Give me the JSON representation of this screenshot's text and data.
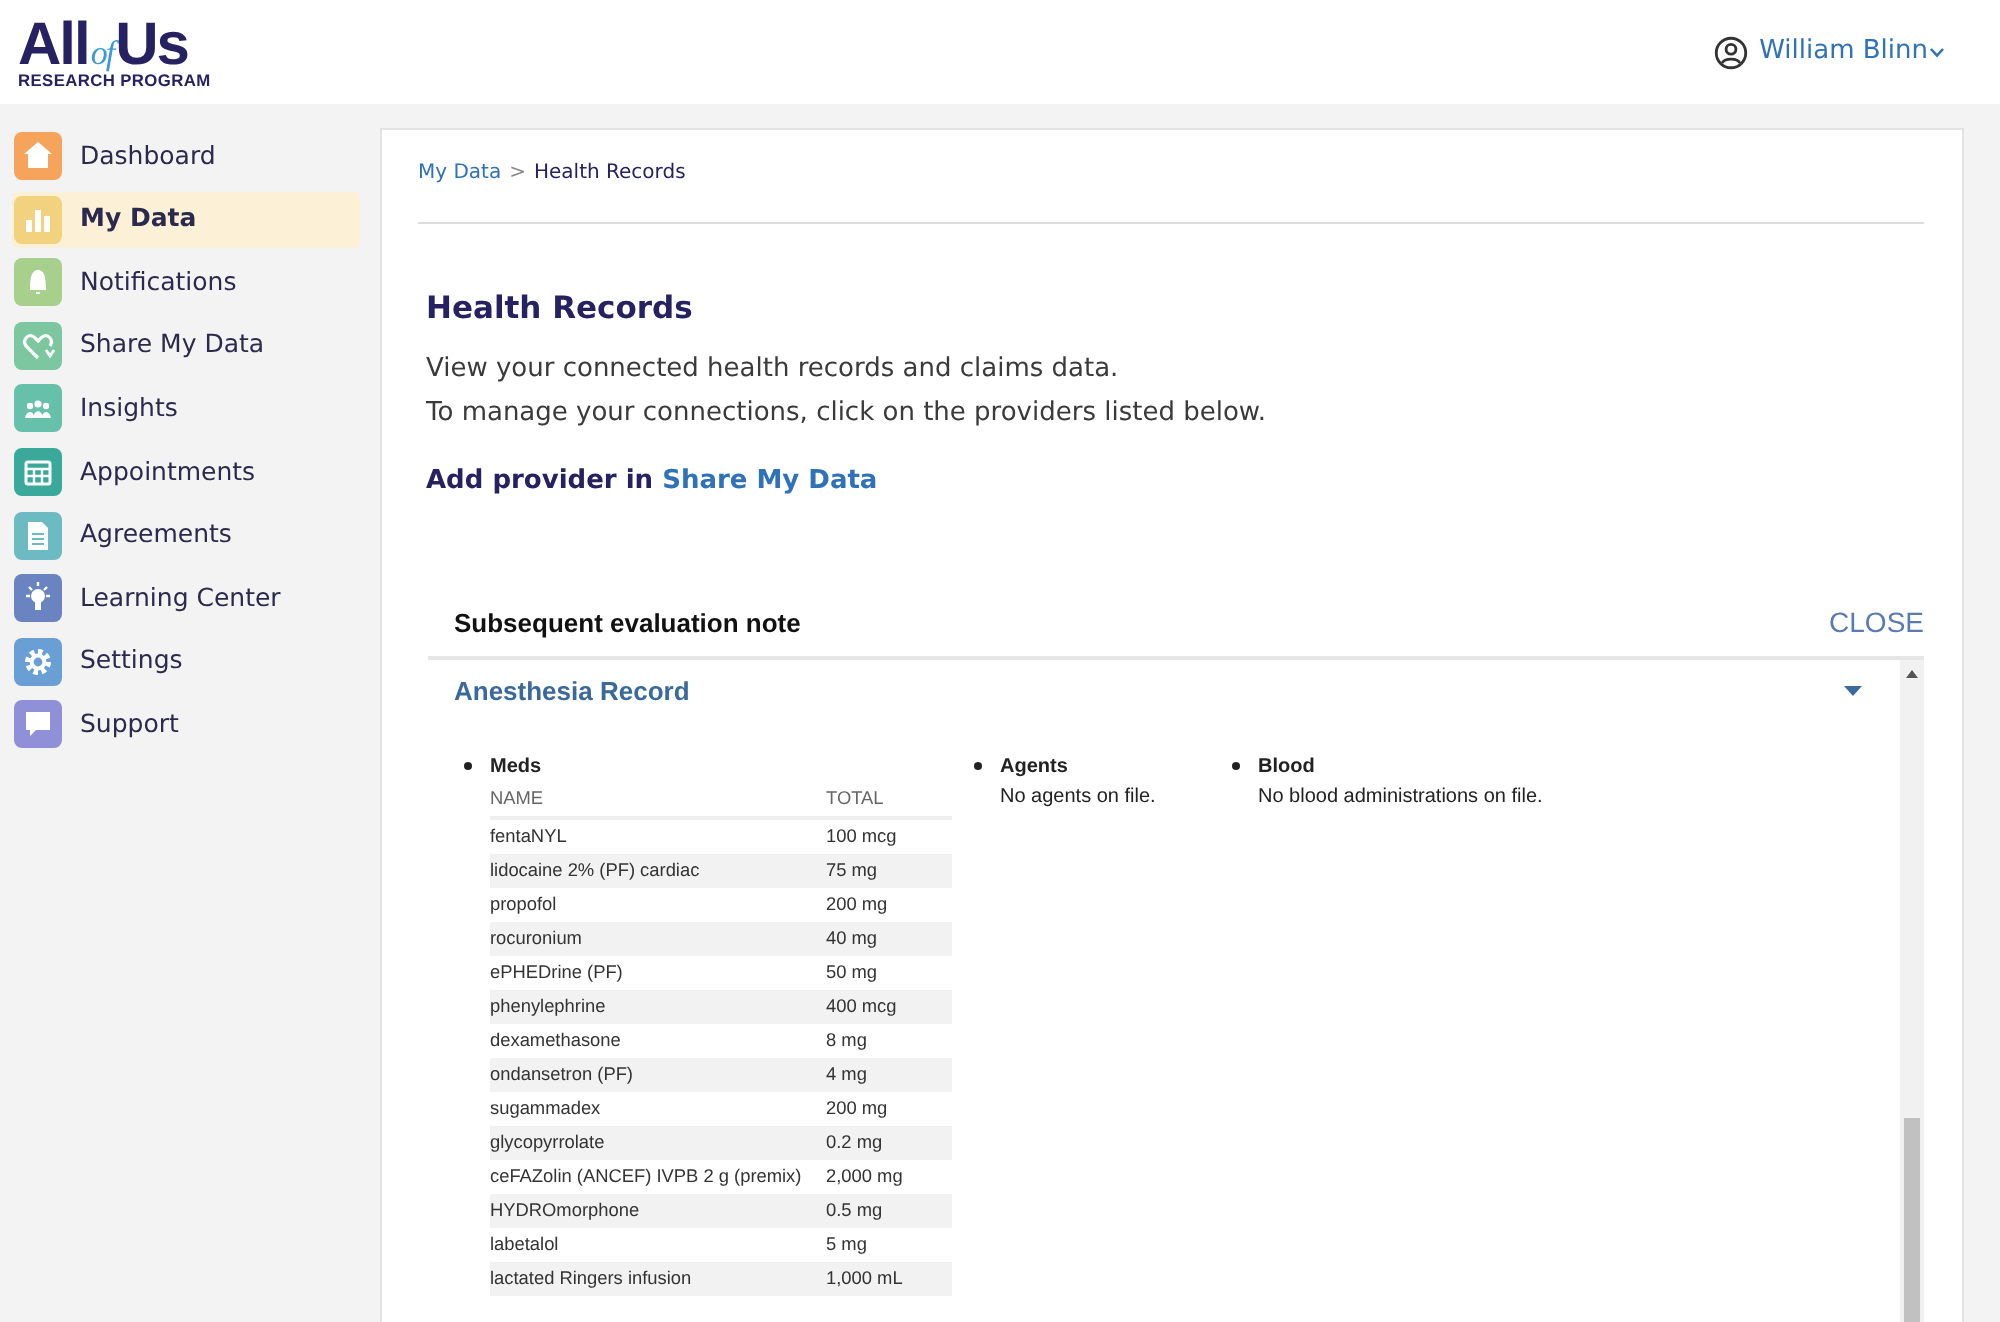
{
  "logo": {
    "word1": "All",
    "word2": "of",
    "word3": "Us",
    "subtitle": "RESEARCH PROGRAM"
  },
  "user": {
    "name": "William Blinn"
  },
  "sidebar": {
    "items": [
      {
        "label": "Dashboard",
        "selected": false,
        "color": "#f6a45c",
        "kind": "home"
      },
      {
        "label": "My Data",
        "selected": true,
        "color": "#f2d27f",
        "kind": "chart"
      },
      {
        "label": "Notifications",
        "selected": false,
        "color": "#a6d08c",
        "kind": "bell"
      },
      {
        "label": "Share My Data",
        "selected": false,
        "color": "#7dc7a0",
        "kind": "heart"
      },
      {
        "label": "Insights",
        "selected": false,
        "color": "#67c0a9",
        "kind": "people"
      },
      {
        "label": "Appointments",
        "selected": false,
        "color": "#3aa89b",
        "kind": "calendar"
      },
      {
        "label": "Agreements",
        "selected": false,
        "color": "#6cbac2",
        "kind": "document"
      },
      {
        "label": "Learning Center",
        "selected": false,
        "color": "#6a84c2",
        "kind": "bulb"
      },
      {
        "label": "Settings",
        "selected": false,
        "color": "#6a9fd6",
        "kind": "gear"
      },
      {
        "label": "Support",
        "selected": false,
        "color": "#9090d8",
        "kind": "chat"
      }
    ]
  },
  "breadcrumb": [
    {
      "label": "My Data",
      "kind": "link"
    },
    {
      "label": ">",
      "kind": "separator"
    },
    {
      "label": "Health Records",
      "kind": "current"
    }
  ],
  "page": {
    "title": "Health Records",
    "lines": [
      "View your connected health records and claims data.",
      "To manage your connections, click on the providers listed below."
    ],
    "add_provider": {
      "text": "Add provider in",
      "link": "Share My Data"
    }
  },
  "note": {
    "title": "Subsequent evaluation note",
    "close": "CLOSE",
    "section": {
      "title": "Anesthesia Record",
      "expanded": true,
      "meds": {
        "title": "Meds",
        "columns": [
          "NAME",
          "TOTAL"
        ],
        "rows": [
          [
            "fentaNYL",
            "100 mcg"
          ],
          [
            "lidocaine 2% (PF) cardiac",
            "75 mg"
          ],
          [
            "propofol",
            "200 mg"
          ],
          [
            "rocuronium",
            "40 mg"
          ],
          [
            "ePHEDrine (PF)",
            "50 mg"
          ],
          [
            "phenylephrine",
            "400 mcg"
          ],
          [
            "dexamethasone",
            "8 mg"
          ],
          [
            "ondansetron (PF)",
            "4 mg"
          ],
          [
            "sugammadex",
            "200 mg"
          ],
          [
            "glycopyrrolate",
            "0.2 mg"
          ],
          [
            "ceFAZolin (ANCEF) IVPB 2 g (premix)",
            "2,000 mg"
          ],
          [
            "HYDROmorphone",
            "0.5 mg"
          ],
          [
            "labetalol",
            "5 mg"
          ],
          [
            "lactated Ringers infusion",
            "1,000 mL"
          ]
        ]
      },
      "other": [
        {
          "title": "Agents",
          "text": "No agents on file."
        },
        {
          "title": "Blood",
          "text": "No blood administrations on file."
        }
      ]
    }
  }
}
